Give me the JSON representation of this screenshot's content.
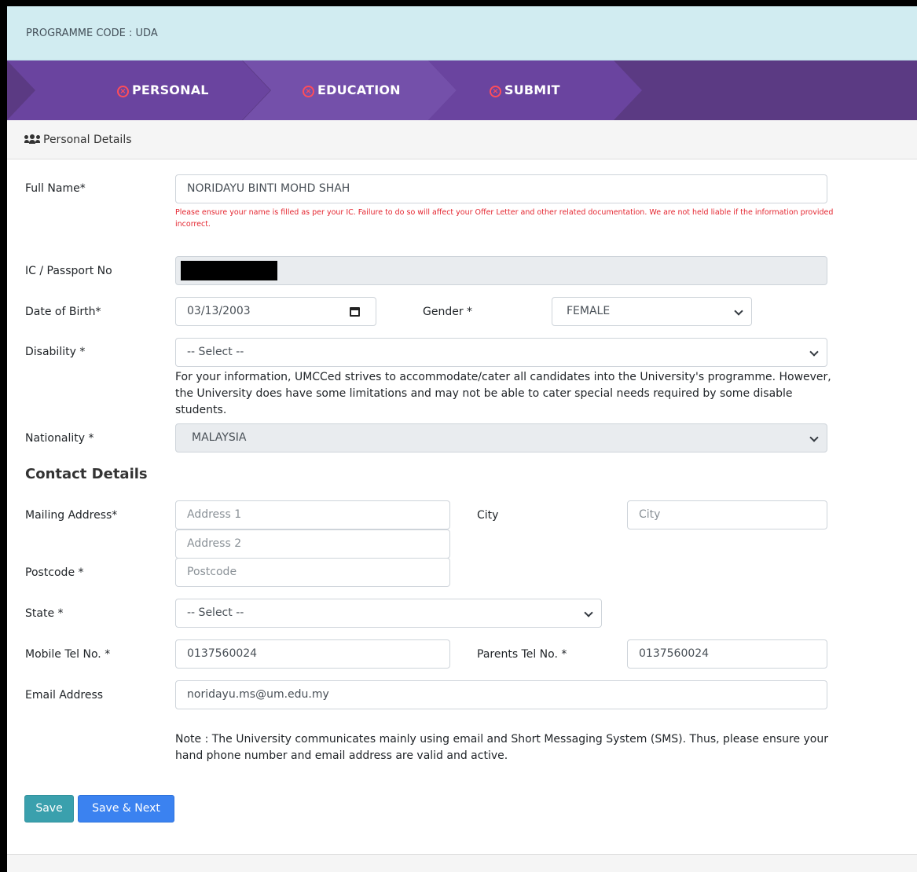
{
  "programme": {
    "text": "PROGRAMME CODE : UDA"
  },
  "steps": [
    {
      "label": "PERSONAL",
      "status_icon": "x-circle-icon"
    },
    {
      "label": "EDUCATION",
      "status_icon": "x-circle-icon"
    },
    {
      "label": "SUBMIT",
      "status_icon": "x-circle-icon"
    }
  ],
  "section": {
    "title": "Personal Details",
    "icon": "users-icon"
  },
  "form": {
    "full_name": {
      "label": "Full Name*",
      "value": "NORIDAYU BINTI MOHD SHAH"
    },
    "name_warning": "Please ensure your name is filled as per your IC. Failure to do so will affect your Offer Letter and other related documentation. We are not held liable if the information provided incorrect.",
    "ic": {
      "label": "IC / Passport No",
      "value": ""
    },
    "dob": {
      "label": "Date of Birth*",
      "value": "03/13/2003"
    },
    "gender": {
      "label": "Gender *",
      "value": "FEMALE"
    },
    "disability": {
      "label": "Disability *",
      "value": "-- Select --"
    },
    "disability_info": "For your information, UMCCed strives to accommodate/cater all candidates into the University's programme. However, the University does have some limitations and may not be able to cater special needs required by some disable students.",
    "nationality": {
      "label": "Nationality *",
      "value": "MALAYSIA"
    }
  },
  "contact": {
    "title": "Contact Details",
    "mailing": {
      "label": "Mailing Address*",
      "address1_placeholder": "Address 1",
      "address2_placeholder": "Address 2"
    },
    "city": {
      "label": "City",
      "placeholder": "City"
    },
    "postcode": {
      "label": "Postcode *",
      "placeholder": "Postcode"
    },
    "state": {
      "label": "State *",
      "value": "-- Select --"
    },
    "mobile": {
      "label": "Mobile Tel No. *",
      "value": "0137560024"
    },
    "parents": {
      "label": "Parents Tel No. *",
      "value": "0137560024"
    },
    "email": {
      "label": "Email Address",
      "value": "noridayu.ms@um.edu.my"
    },
    "note": "Note : The University communicates mainly using email and Short Messaging System (SMS). Thus, please ensure your hand phone number and email address are valid and active."
  },
  "buttons": {
    "save": "Save",
    "save_next": "Save & Next"
  },
  "colors": {
    "stepper_bg": "#5b3a83",
    "step_active": "#6b45a0",
    "warning_text": "#e4252f",
    "info_bar": "#d1ecf1",
    "save_btn": "#3aa0ad",
    "next_btn": "#3b82f0"
  }
}
